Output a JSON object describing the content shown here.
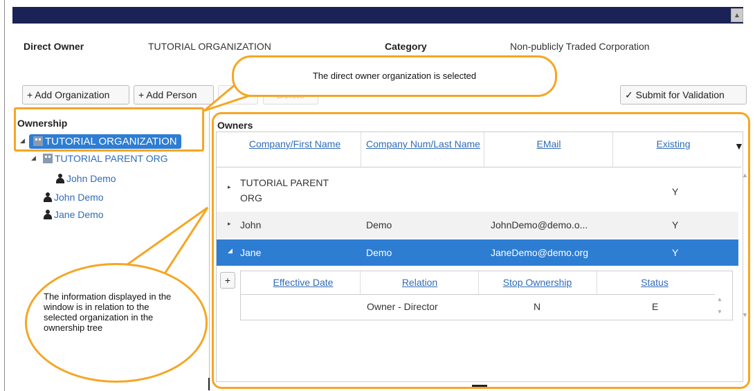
{
  "header": {
    "direct_owner_label": "Direct Owner",
    "direct_owner_value": "TUTORIAL ORGANIZATION",
    "category_label": "Category",
    "category_value": "Non-publicly Traded Corporation"
  },
  "toolbar": {
    "add_org": "+ Add Organization",
    "add_person": "+ Add Person",
    "edit": "Edit",
    "delete": "Delete",
    "submit": "✓ Submit for Validation"
  },
  "tree": {
    "title": "Ownership",
    "root": "TUTORIAL ORGANIZATION",
    "child_org": "TUTORIAL PARENT ORG",
    "child_person": "John Demo",
    "person1": "John Demo",
    "person2": "Jane Demo"
  },
  "owners": {
    "title": "Owners",
    "columns": [
      "Company/First Name",
      "Company Num/Last Name",
      "EMail",
      "Existing"
    ],
    "rows": [
      {
        "first": "TUTORIAL PARENT ORG",
        "last": "",
        "email": "",
        "existing": "Y"
      },
      {
        "first": "John",
        "last": "Demo",
        "email": "JohnDemo@demo.o...",
        "existing": "Y"
      },
      {
        "first": "Jane",
        "last": "Demo",
        "email": "JaneDemo@demo.org",
        "existing": "Y"
      }
    ],
    "sub_columns": [
      "Effective Date",
      "Relation",
      "Stop Ownership",
      "Status"
    ],
    "sub_row": {
      "effective": "",
      "relation": "Owner - Director",
      "stop": "N",
      "status": "E"
    },
    "add_symbol": "+"
  },
  "callouts": {
    "top": "The direct owner organization is selected",
    "left": "The information displayed in the window is in relation to the selected organization in the ownership tree"
  },
  "colors": {
    "accent": "#f5a623",
    "selection": "#2d7dd2",
    "link": "#2f6cb8",
    "topbar": "#1b2255"
  }
}
